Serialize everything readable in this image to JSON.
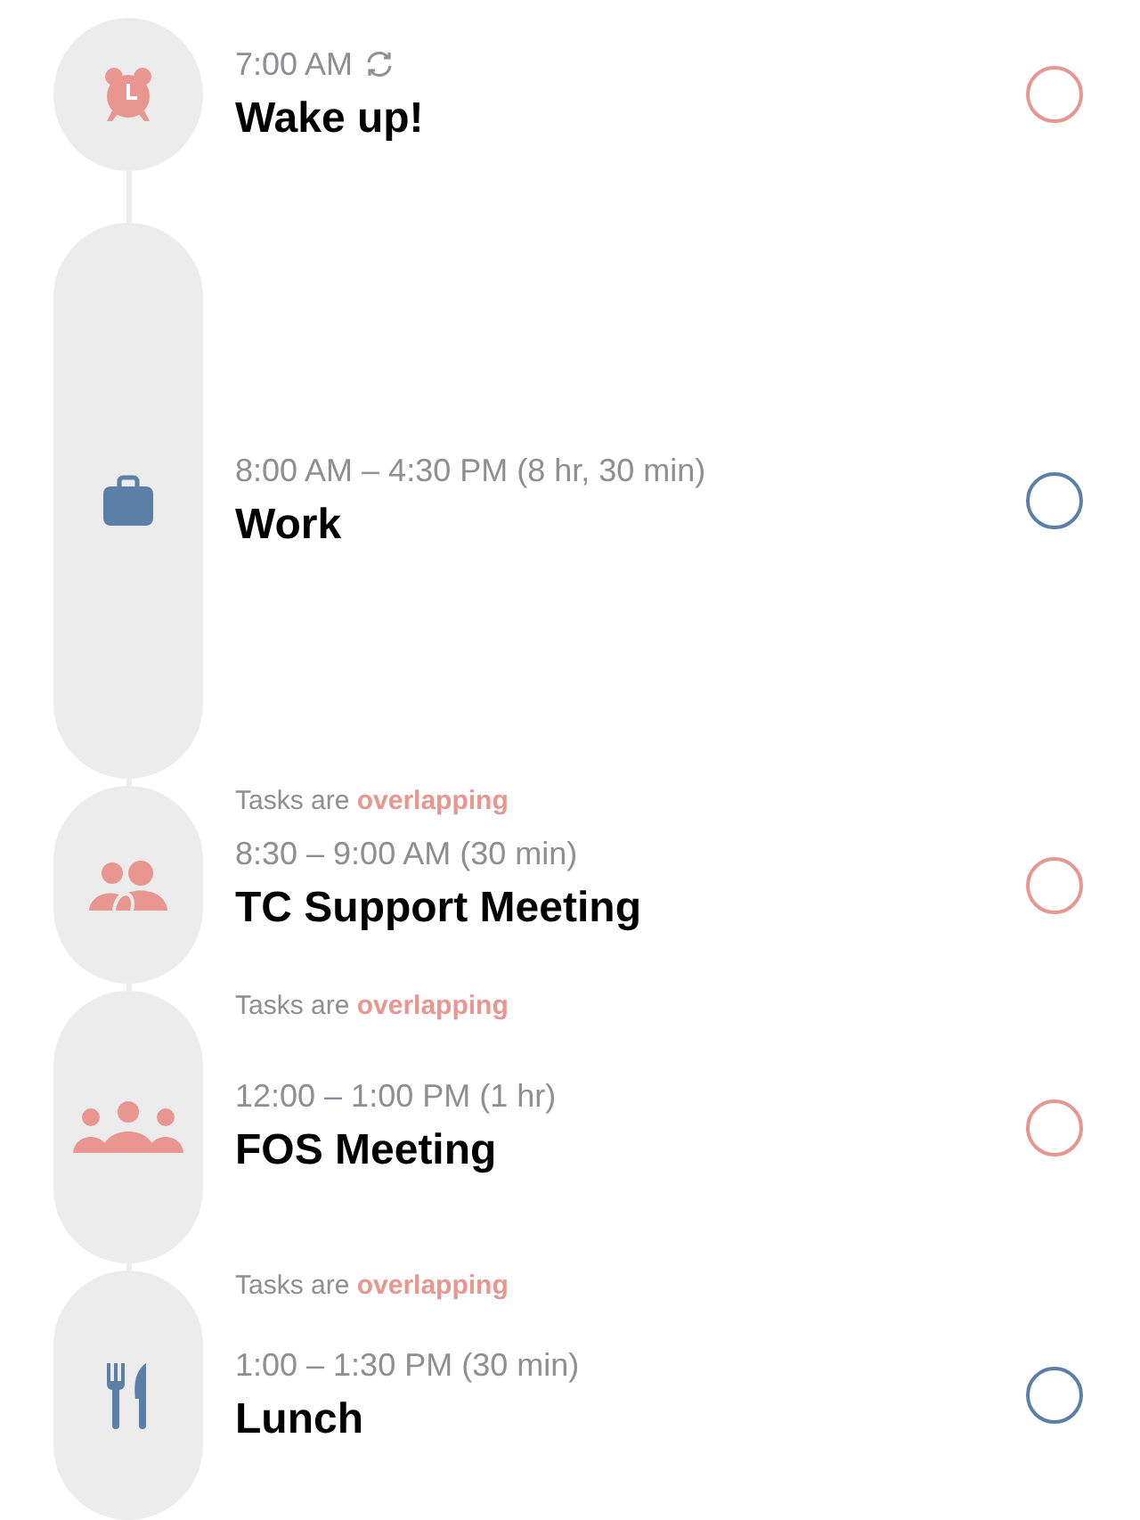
{
  "tasks": [
    {
      "kind": "alarm",
      "color": "#e8968f",
      "time": "7:00 AM",
      "repeats": true,
      "title": "Wake up!",
      "completed": false
    },
    {
      "kind": "work",
      "color": "#5b7fa6",
      "time": "8:00 AM – 4:30 PM (8 hr, 30 min)",
      "repeats": false,
      "title": "Work",
      "completed": false
    },
    {
      "kind": "meeting",
      "color": "#e8968f",
      "overlap_note": {
        "text": "Tasks are",
        "highlight": "overlapping"
      },
      "time": "8:30 – 9:00 AM (30 min)",
      "repeats": false,
      "title": "TC Support Meeting",
      "completed": false
    },
    {
      "kind": "group",
      "color": "#e8968f",
      "overlap_note": {
        "text": "Tasks are",
        "highlight": "overlapping"
      },
      "time": "12:00 – 1:00 PM (1 hr)",
      "repeats": false,
      "title": "FOS Meeting",
      "completed": false
    },
    {
      "kind": "meal",
      "color": "#5b7fa6",
      "overlap_note": {
        "text": "Tasks are",
        "highlight": "overlapping"
      },
      "time": "1:00 – 1:30 PM (30 min)",
      "repeats": false,
      "title": "Lunch",
      "completed": false
    }
  ]
}
